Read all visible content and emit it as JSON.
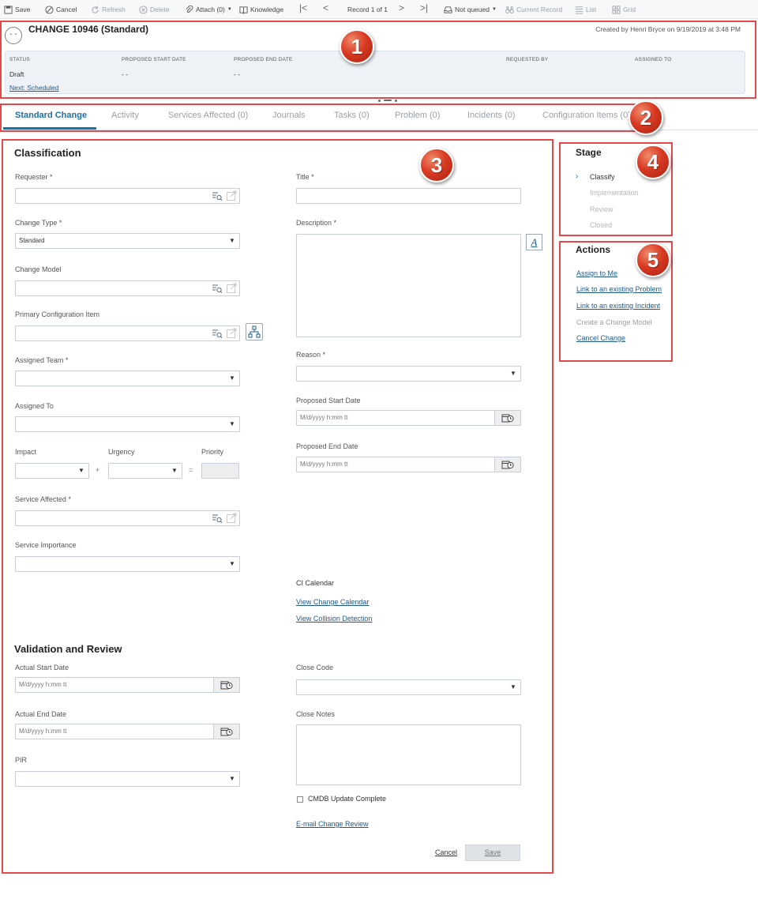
{
  "toolbar": {
    "save": "Save",
    "cancel": "Cancel",
    "refresh": "Refresh",
    "delete": "Delete",
    "attach": "Attach (0)",
    "knowledge": "Knowledge",
    "record_counter": "Record 1 of 1",
    "not_queued": "Not queued",
    "current_record": "Current Record",
    "list": "List",
    "grid": "Grid",
    "nav_first": "|<",
    "nav_prev": "<",
    "nav_next": ">",
    "nav_last": ">|"
  },
  "header": {
    "toggle": "- -",
    "title": "CHANGE 10946 (Standard)",
    "created_by": "Created by Henri Bryce on 9/19/2019 at 3:48 PM",
    "summary": {
      "status_label": "STATUS",
      "status_value": "Draft",
      "next_link": "Next: Scheduled",
      "proposed_start_label": "PROPOSED START DATE",
      "proposed_start_value": "- -",
      "proposed_end_label": "PROPOSED END DATE",
      "proposed_end_value": "- -",
      "requested_by_label": "REQUESTED BY",
      "assigned_to_label": "ASSIGNED TO"
    }
  },
  "tabs": [
    {
      "label": "Standard Change"
    },
    {
      "label": "Activity"
    },
    {
      "label": "Services Affected (0)"
    },
    {
      "label": "Journals"
    },
    {
      "label": "Tasks (0)"
    },
    {
      "label": "Problem (0)"
    },
    {
      "label": "Incidents (0)"
    },
    {
      "label": "Configuration Items (0)"
    }
  ],
  "form": {
    "classification_title": "Classification",
    "requester_label": "Requester *",
    "change_type_label": "Change Type *",
    "change_type_value": "Standard",
    "change_model_label": "Change Model",
    "primary_ci_label": "Primary Configuration Item",
    "assigned_team_label": "Assigned Team *",
    "assigned_to_label": "Assigned To",
    "impact_label": "Impact",
    "urgency_label": "Urgency",
    "priority_label": "Priority",
    "plus_op": "+",
    "equals_op": "=",
    "service_affected_label": "Service Affected *",
    "service_importance_label": "Service Importance",
    "title_label": "Title *",
    "description_label": "Description *",
    "reason_label": "Reason *",
    "proposed_start_label": "Proposed Start Date",
    "proposed_end_label": "Proposed End Date",
    "date_placeholder": "M/d/yyyy h:mm tt",
    "ci_calendar_label": "CI Calendar",
    "view_change_calendar": "View Change Calendar",
    "view_collision_detection": "View Collision Detection",
    "validation_title": "Validation and Review",
    "actual_start_label": "Actual Start Date",
    "actual_end_label": "Actual End Date",
    "pir_label": "PIR",
    "close_code_label": "Close Code",
    "close_notes_label": "Close Notes",
    "cmdb_update_label": "CMDB Update Complete",
    "email_change_review": "E-mail Change Review",
    "cancel_link": "Cancel",
    "save_button": "Save",
    "format_button": "A"
  },
  "stage": {
    "title": "Stage",
    "items": [
      "Classify",
      "Implementation",
      "Review",
      "Closed"
    ]
  },
  "actions": {
    "title": "Actions",
    "items": [
      "Assign to Me",
      "Link to an existing Problem",
      "Link to an existing Incident",
      "Create a Change Model",
      "Cancel Change"
    ]
  },
  "callouts": [
    "1",
    "2",
    "3",
    "4",
    "5"
  ],
  "colors": {
    "accent": "#1e6fa3",
    "highlight_box": "#e24a4a",
    "callout": "#d93a23",
    "summary_bg": "#eef2f7"
  }
}
